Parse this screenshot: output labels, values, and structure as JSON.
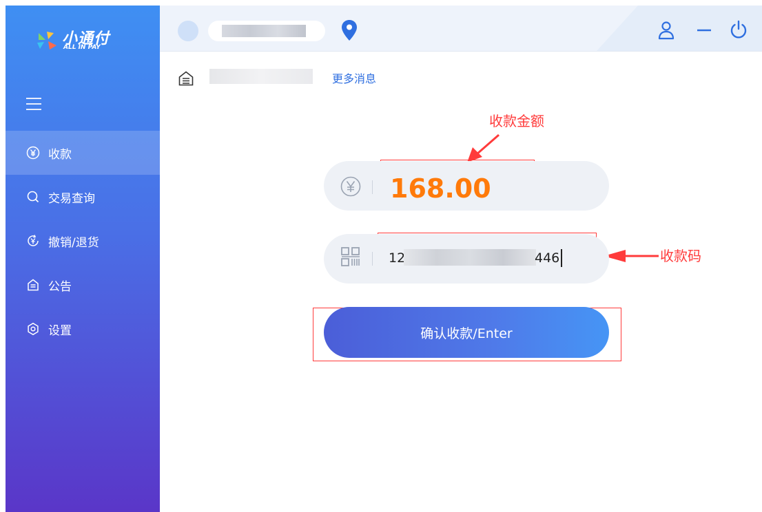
{
  "app": {
    "brand_name": "小通付",
    "brand_sub": "ALL IN PAY",
    "store_name": "",
    "colors": {
      "accent": "#4a6fe6",
      "amount": "#ff7a0a",
      "annotation": "#ff3b3b",
      "link": "#2f6fe0"
    }
  },
  "sidebar": {
    "items": [
      {
        "label": "收款",
        "icon": "yen-circle-icon",
        "active": true
      },
      {
        "label": "交易查询",
        "icon": "search-icon",
        "active": false
      },
      {
        "label": "撤销/退货",
        "icon": "refund-icon",
        "active": false
      },
      {
        "label": "公告",
        "icon": "notice-icon",
        "active": false
      },
      {
        "label": "设置",
        "icon": "gear-icon",
        "active": false
      }
    ]
  },
  "topbar": {
    "icons": [
      "location-pin-icon",
      "user-icon",
      "minimize-icon",
      "power-icon"
    ]
  },
  "notice": {
    "text": "",
    "more_label": "更多消息"
  },
  "payment": {
    "amount": "168.00",
    "code_prefix": "12",
    "code_suffix": "446",
    "confirm_label": "确认收款/Enter"
  },
  "annotations": {
    "amount_label": "收款金额",
    "code_label": "收款码"
  }
}
